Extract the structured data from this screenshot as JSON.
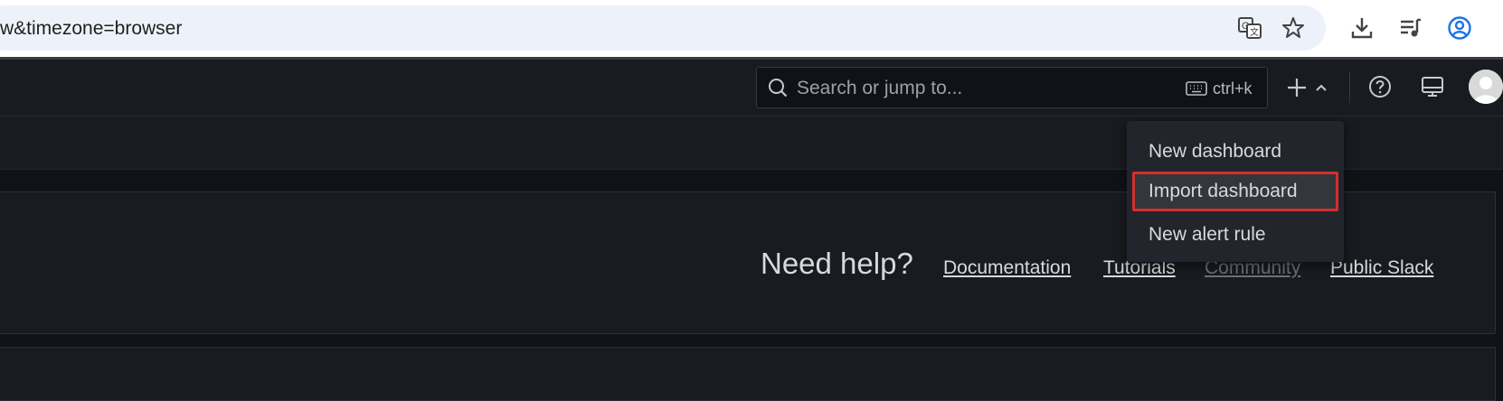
{
  "browser": {
    "url_fragment": "w&timezone=browser",
    "icons": [
      "translate-icon",
      "star-icon",
      "download-icon",
      "media-queue-icon",
      "profile-icon"
    ]
  },
  "topnav": {
    "search_placeholder": "Search or jump to...",
    "shortcut": "ctrl+k",
    "icons": [
      "plus-icon",
      "chevron-up-icon",
      "help-icon",
      "news-icon",
      "avatar"
    ]
  },
  "dropdown": {
    "items": [
      {
        "label": "New dashboard"
      },
      {
        "label": "Import dashboard"
      },
      {
        "label": "New alert rule"
      }
    ]
  },
  "help": {
    "title": "Need help?",
    "links": [
      "Documentation",
      "Tutorials",
      "Community",
      "Public Slack"
    ]
  },
  "colors": {
    "background": "#111217",
    "panel": "#181b1f",
    "highlight_border": "#d32f2f"
  }
}
